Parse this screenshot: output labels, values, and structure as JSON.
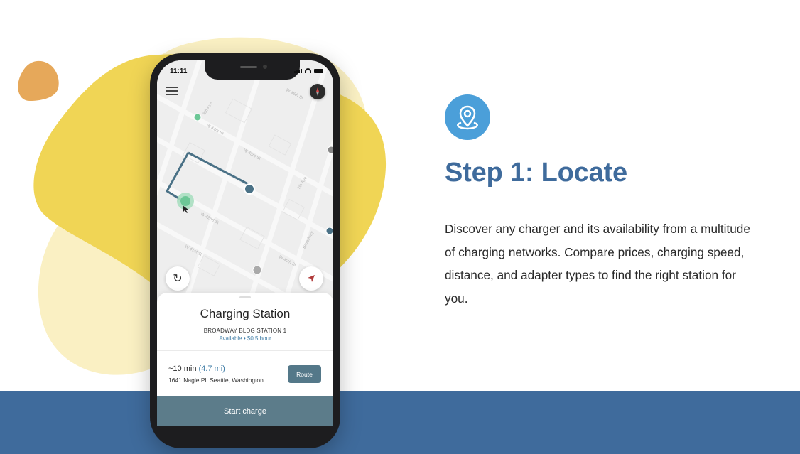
{
  "phone": {
    "status_time": "11:11",
    "map": {
      "street_labels": [
        "W 45th St",
        "8th Ave",
        "W 44th St",
        "W 43rd St",
        "W 42nd St",
        "7th Ave",
        "Broadway",
        "W 41st St",
        "W 40th St"
      ]
    },
    "sheet": {
      "title": "Charging Station",
      "station_name": "BROADWAY BLDG STATION 1",
      "availability": "Available • $0.5 hour",
      "eta": "~10 min",
      "distance": "(4.7 mi)",
      "address": "1641 Nagle Pl, Seattle, Washington",
      "route_label": "Route",
      "start_label": "Start charge"
    }
  },
  "content": {
    "title": "Step 1: Locate",
    "description": "Discover any charger and its availability from a multitude of charging networks. Compare prices, charging speed, distance, and adapter types to find the right station for you."
  },
  "colors": {
    "accent_blue": "#3f6b9c",
    "badge_blue": "#4b9fd9",
    "blob_yellow": "#f0d555",
    "blob_orange": "#e6a85a",
    "route_teal": "#547889"
  }
}
